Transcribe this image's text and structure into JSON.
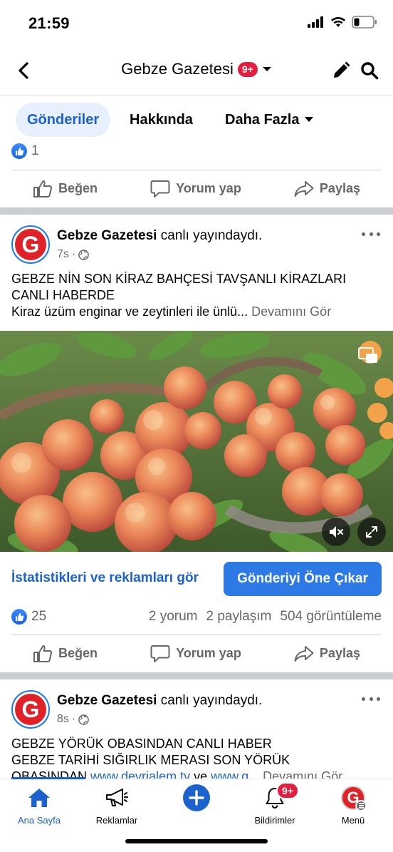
{
  "status_bar": {
    "time": "21:59"
  },
  "header": {
    "title": "Gebze Gazetesi",
    "badge": "9+"
  },
  "tabs": [
    {
      "label": "Gönderiler"
    },
    {
      "label": "Hakkında"
    },
    {
      "label": "Daha Fazla"
    }
  ],
  "prev_post": {
    "like_count": "1"
  },
  "actions": {
    "like": "Beğen",
    "comment": "Yorum yap",
    "share": "Paylaş"
  },
  "post1": {
    "author": "Gebze Gazetesi",
    "status": " canlı yayındaydı.",
    "time": "7s",
    "line1": "GEBZE NİN SON KİRAZ  BAHÇESİ TAVŞANLI  KİRAZLARI",
    "line2": "CANLI HABERDE",
    "line3": "Kiraz üzüm enginar ve zeytinleri ile ünlü...",
    "see_more": " Devamını Gör",
    "stats_link": "İstatistikleri ve reklamları gör",
    "boost": "Gönderiyi Öne Çıkar",
    "likes": "25",
    "comments": "2 yorum",
    "shares": "2 paylaşım",
    "views": "504 görüntüleme"
  },
  "post2": {
    "author": "Gebze Gazetesi",
    "status": " canlı yayındaydı.",
    "time": "8s",
    "line1": "GEBZE YÖRÜK OBASINDAN CANLI HABER",
    "line2": "GEBZE TARİHİ SIĞIRLIK MERASI SON YÖRÜK",
    "line3_prefix": "OBASINDAN ",
    "line3_link": "www.devrialem.tv",
    "line3_mid": " ve ",
    "line3_link2": "www.g...",
    "see_more": " Devamını Gör"
  },
  "bottom_nav": [
    {
      "label": "Ana Sayfa",
      "icon": "home-icon"
    },
    {
      "label": "Reklamlar",
      "icon": "megaphone-icon"
    },
    {
      "label": "",
      "icon": "plus-icon"
    },
    {
      "label": "Bildirimler",
      "icon": "bell-icon",
      "badge": "9+"
    },
    {
      "label": "Menü",
      "icon": "menu-avatar-icon"
    }
  ],
  "colors": {
    "accent": "#1b62cf",
    "badge": "#e41e3f",
    "boost": "#2d7ae6",
    "brand_logo": "#e02128"
  }
}
